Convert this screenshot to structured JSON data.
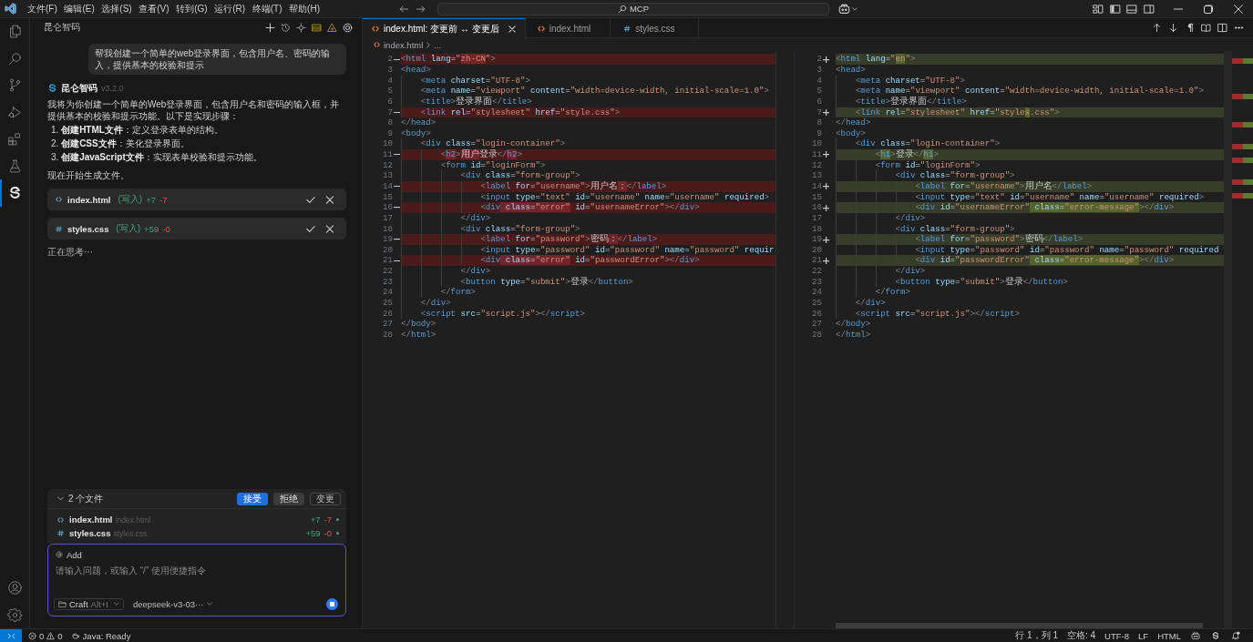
{
  "title_bar": {
    "menu": [
      "文件(F)",
      "编辑(E)",
      "选择(S)",
      "查看(V)",
      "转到(G)",
      "运行(R)",
      "终端(T)",
      "帮助(H)"
    ],
    "command_center": "MCP"
  },
  "activity_bar": {
    "items": [
      {
        "selected": false
      },
      {
        "selected": false
      },
      {
        "selected": false
      },
      {
        "selected": false
      },
      {
        "selected": false
      },
      {
        "selected": false
      },
      {
        "selected": true
      }
    ]
  },
  "chat": {
    "title": "昆仑智码",
    "user_message": "帮我创建一个简单的web登录界面，包含用户名、密码的输入，提供基本的校验和提示",
    "assistant": {
      "name": "昆仑智码",
      "version": "v3.2.0",
      "intro": "我将为你创建一个简单的Web登录界面，包含用户名和密码的输入框，并提供基本的校验和提示功能。以下是实现步骤：",
      "steps": [
        "1. **创建HTML文件**：定义登录表单的结构。",
        "2. **创建CSS文件**：美化登录界面。",
        "3. **创建JavaScript文件**：实现表单校验和提示功能。"
      ],
      "outro": "现在开始生成文件。"
    },
    "file_edits": [
      {
        "kind": "html",
        "name": "index.html",
        "action": "(写入)",
        "added": "+7",
        "removed": "-7"
      },
      {
        "kind": "css",
        "name": "styles.css",
        "action": "(写入)",
        "added": "+59",
        "removed": "-0"
      }
    ],
    "status": "正在思考···",
    "changes": {
      "expanded": true,
      "title": "2 个文件",
      "buttons": [
        {
          "kind": "primary",
          "label": "接受"
        },
        {
          "kind": "secondary",
          "label": "拒绝"
        },
        {
          "kind": "outline",
          "label": "变更"
        }
      ],
      "files": [
        {
          "kind": "html",
          "name": "index.html",
          "path": "index.html",
          "added": "+7",
          "removed": "-7"
        },
        {
          "kind": "css",
          "name": "styles.css",
          "path": "styles.css",
          "added": "+59",
          "removed": "-0"
        }
      ]
    },
    "composer": {
      "mention": "Add",
      "placeholder": "请输入问题，或输入 “/” 使用便捷指令",
      "mode": "Craft",
      "mode_shortcut": "Alt+I",
      "model": "deepseek-v3-03···"
    }
  },
  "editor": {
    "tabs": [
      {
        "kind": "html",
        "label": "index.html: 变更前 ↔ 变更后",
        "selected": true
      },
      {
        "kind": "html",
        "label": "index.html",
        "selected": false
      },
      {
        "kind": "css",
        "label": "styles.css",
        "selected": false
      }
    ],
    "breadcrumb": {
      "kind": "html",
      "file": "index.html",
      "more": "..."
    },
    "diff": {
      "left": [
        {
          "number": "2",
          "modified": true,
          "segments": [
            {
              "text": "<html lang=\"",
              "changed": false
            },
            {
              "text": "zh-CN",
              "changed": true
            },
            {
              "text": "\">",
              "changed": false
            }
          ]
        },
        {
          "number": "3",
          "modified": false,
          "text": "<head>"
        },
        {
          "number": "4",
          "modified": false,
          "text": "    <meta charset=\"UTF-8\">"
        },
        {
          "number": "5",
          "modified": false,
          "text": "    <meta name=\"viewport\" content=\"width=device-width, initial-scale=1.0\">"
        },
        {
          "number": "6",
          "modified": false,
          "text": "    <title>登录界面</title>"
        },
        {
          "number": "7",
          "modified": true,
          "text": "    <link rel=\"stylesheet\" href=\"style.css\">"
        },
        {
          "number": "8",
          "modified": false,
          "text": "</head>"
        },
        {
          "number": "9",
          "modified": false,
          "text": "<body>"
        },
        {
          "number": "10",
          "modified": false,
          "text": "    <div class=\"login-container\">"
        },
        {
          "number": "11",
          "modified": true,
          "segments": [
            {
              "text": "        <",
              "changed": false
            },
            {
              "text": "h2",
              "changed": true
            },
            {
              "text": ">",
              "changed": false
            },
            {
              "text": "用户",
              "changed": true
            },
            {
              "text": "登录</",
              "changed": false
            },
            {
              "text": "h2",
              "changed": true
            },
            {
              "text": ">",
              "changed": false
            }
          ]
        },
        {
          "number": "12",
          "modified": false,
          "text": "        <form id=\"loginForm\">"
        },
        {
          "number": "13",
          "modified": false,
          "text": "            <div class=\"form-group\">"
        },
        {
          "number": "14",
          "modified": true,
          "segments": [
            {
              "text": "                <label for=\"username\">用户名",
              "changed": false
            },
            {
              "text": "：",
              "changed": true
            },
            {
              "text": "</label>",
              "changed": false
            }
          ]
        },
        {
          "number": "15",
          "modified": false,
          "text": "                <input type=\"text\" id=\"username\" name=\"username\" required>"
        },
        {
          "number": "16",
          "modified": true,
          "segments": [
            {
              "text": "                <div",
              "changed": false
            },
            {
              "text": " class=\"error\"",
              "changed": true
            },
            {
              "text": " id=\"usernameError\"></div>",
              "changed": false
            }
          ]
        },
        {
          "number": "17",
          "modified": false,
          "text": "            </div>"
        },
        {
          "number": "18",
          "modified": false,
          "text": "            <div class=\"form-group\">"
        },
        {
          "number": "19",
          "modified": true,
          "segments": [
            {
              "text": "                <label for=\"password\">密码",
              "changed": false
            },
            {
              "text": "：",
              "changed": true
            },
            {
              "text": "</label>",
              "changed": false
            }
          ]
        },
        {
          "number": "20",
          "modified": false,
          "text": "                <input type=\"password\" id=\"password\" name=\"password\" requir"
        },
        {
          "number": "21",
          "modified": true,
          "segments": [
            {
              "text": "                <div",
              "changed": false
            },
            {
              "text": " class=\"error\"",
              "changed": true
            },
            {
              "text": " id=\"passwordError\"></div>",
              "changed": false
            }
          ]
        },
        {
          "number": "22",
          "modified": false,
          "text": "            </div>"
        },
        {
          "number": "23",
          "modified": false,
          "text": "            <button type=\"submit\">登录</button>"
        },
        {
          "number": "24",
          "modified": false,
          "text": "        </form>"
        },
        {
          "number": "25",
          "modified": false,
          "text": "    </div>"
        },
        {
          "number": "26",
          "modified": false,
          "text": "    <script src=\"script.js\"></script>"
        },
        {
          "number": "27",
          "modified": false,
          "text": "</body>"
        },
        {
          "number": "28",
          "modified": false,
          "text": "</html>"
        }
      ],
      "right": [
        {
          "number": "2",
          "modified": true,
          "segments": [
            {
              "text": "<html lang=\"",
              "changed": false
            },
            {
              "text": "en",
              "changed": true
            },
            {
              "text": "\">",
              "changed": false
            }
          ]
        },
        {
          "number": "3",
          "modified": false,
          "text": "<head>"
        },
        {
          "number": "4",
          "modified": false,
          "text": "    <meta charset=\"UTF-8\">"
        },
        {
          "number": "5",
          "modified": false,
          "text": "    <meta name=\"viewport\" content=\"width=device-width, initial-scale=1.0\">"
        },
        {
          "number": "6",
          "modified": false,
          "text": "    <title>登录界面</title>"
        },
        {
          "number": "7",
          "modified": true,
          "segments": [
            {
              "text": "    <link rel=\"stylesheet\" href=\"style",
              "changed": false
            },
            {
              "text": "s",
              "changed": true
            },
            {
              "text": ".css\">",
              "changed": false
            }
          ]
        },
        {
          "number": "8",
          "modified": false,
          "text": "</head>"
        },
        {
          "number": "9",
          "modified": false,
          "text": "<body>"
        },
        {
          "number": "10",
          "modified": false,
          "text": "    <div class=\"login-container\">"
        },
        {
          "number": "11",
          "modified": true,
          "segments": [
            {
              "text": "        <",
              "changed": false
            },
            {
              "text": "h1",
              "changed": true
            },
            {
              "text": ">登录</",
              "changed": false
            },
            {
              "text": "h1",
              "changed": true
            },
            {
              "text": ">",
              "changed": false
            }
          ]
        },
        {
          "number": "12",
          "modified": false,
          "text": "        <form id=\"loginForm\">"
        },
        {
          "number": "13",
          "modified": false,
          "text": "            <div class=\"form-group\">"
        },
        {
          "number": "14",
          "modified": true,
          "text": "                <label for=\"username\">用户名</label>"
        },
        {
          "number": "15",
          "modified": false,
          "text": "                <input type=\"text\" id=\"username\" name=\"username\" required>"
        },
        {
          "number": "16",
          "modified": true,
          "segments": [
            {
              "text": "                <div id=\"usernameError\"",
              "changed": false
            },
            {
              "text": " class=\"error-message\"",
              "changed": true
            },
            {
              "text": "></div>",
              "changed": false
            }
          ]
        },
        {
          "number": "17",
          "modified": false,
          "text": "            </div>"
        },
        {
          "number": "18",
          "modified": false,
          "text": "            <div class=\"form-group\">"
        },
        {
          "number": "19",
          "modified": true,
          "text": "                <label for=\"password\">密码</label>"
        },
        {
          "number": "20",
          "modified": false,
          "text": "                <input type=\"password\" id=\"password\" name=\"password\" required"
        },
        {
          "number": "21",
          "modified": true,
          "segments": [
            {
              "text": "                <div id=\"passwordError\"",
              "changed": false
            },
            {
              "text": " class=\"error-message\"",
              "changed": true
            },
            {
              "text": "></div>",
              "changed": false
            }
          ]
        },
        {
          "number": "22",
          "modified": false,
          "text": "            </div>"
        },
        {
          "number": "23",
          "modified": false,
          "text": "            <button type=\"submit\">登录</button>"
        },
        {
          "number": "24",
          "modified": false,
          "text": "        </form>"
        },
        {
          "number": "25",
          "modified": false,
          "text": "    </div>"
        },
        {
          "number": "26",
          "modified": false,
          "text": "    <script src=\"script.js\"></script>"
        },
        {
          "number": "27",
          "modified": false,
          "text": "</body>"
        },
        {
          "number": "28",
          "modified": false,
          "text": "</html>"
        }
      ]
    }
  },
  "status_bar": {
    "errors": "0",
    "warnings": "0",
    "java": "Java: Ready",
    "position": "行 1，列 1",
    "indent": "空格: 4",
    "encoding": "UTF-8",
    "eol": "LF",
    "language": "HTML"
  }
}
